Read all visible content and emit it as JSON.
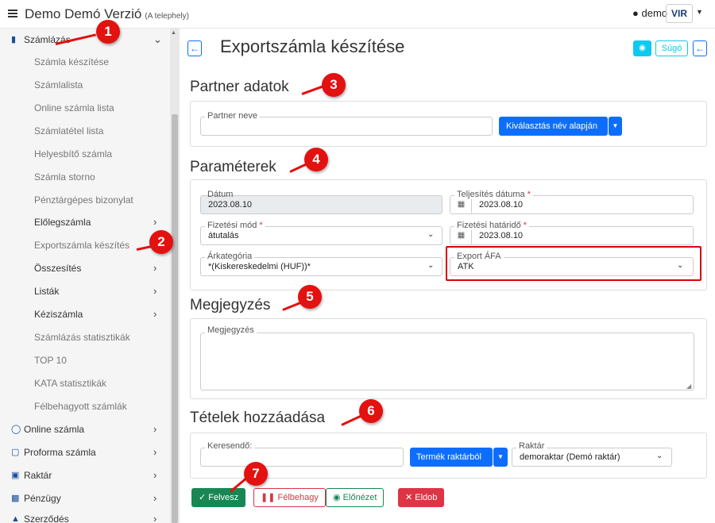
{
  "header": {
    "title": "Demo Demó Verzió",
    "site": "(A telephely)",
    "user": "demo",
    "logo": "VIR"
  },
  "sidebar": {
    "top_item": "Számlázás",
    "items": [
      "Számla készítése",
      "Számlalista",
      "Online számla lista",
      "Számlatétel lista",
      "Helyesbítő számla",
      "Számla storno",
      "Pénztárgépes bizonylat",
      "Előlegszámla",
      "Exportszámla készítés",
      "Összesítés",
      "Listák",
      "Kéziszámla",
      "Számlázás statisztikák",
      "TOP 10",
      "KATA statisztikák",
      "Félbehagyott számlák"
    ],
    "bottom": [
      "Online számla",
      "Proforma számla",
      "Raktár",
      "Pénzügy",
      "Szerződés"
    ]
  },
  "page": {
    "title": "Exportszámla készítése",
    "help": "Súgó"
  },
  "partner": {
    "section": "Partner adatok",
    "label": "Partner neve",
    "value": "",
    "select_button": "Kiválasztás név alapján"
  },
  "params": {
    "section": "Paraméterek",
    "date_label": "Dátum",
    "date_value": "2023.08.10",
    "perf_label": "Teljesítés dátuma",
    "perf_value": "2023.08.10",
    "pay_label": "Fizetési mód",
    "pay_value": "átutalás",
    "due_label": "Fizetési határidő",
    "due_value": "2023.08.10",
    "price_label": "Árkategória",
    "price_value": "*(Kiskereskedelmi (HUF))*",
    "vat_label": "Export ÁFA",
    "vat_value": "ATK",
    "req": "*"
  },
  "note": {
    "section": "Megjegyzés",
    "label": "Megjegyzés",
    "value": ""
  },
  "items": {
    "section": "Tételek hozzáadása",
    "search_label": "Keresendő:",
    "search_value": "",
    "product_button": "Termék raktárból",
    "warehouse_label": "Raktár",
    "warehouse_value": "demoraktar (Demó raktár)"
  },
  "actions": {
    "add": "Felvesz",
    "pause": "Félbehagy",
    "preview": "Előnézet",
    "discard": "Eldob"
  },
  "badges": [
    "1",
    "2",
    "3",
    "4",
    "5",
    "6",
    "7"
  ],
  "colors": {
    "primary": "#0d6efd",
    "success": "#198754",
    "danger": "#dc3545",
    "info": "#0dcaf0",
    "badge": "#e3110f"
  }
}
